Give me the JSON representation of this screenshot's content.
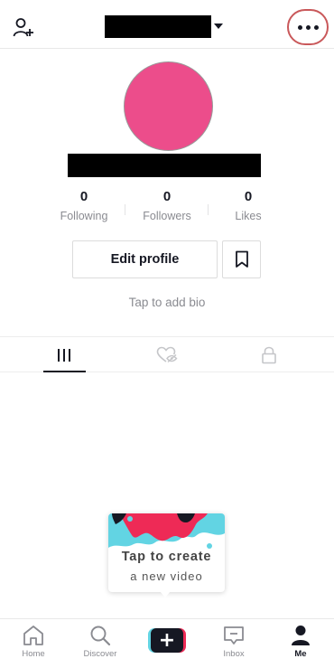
{
  "header": {
    "username_redacted": true,
    "more_menu_highlighted": true
  },
  "profile": {
    "avatar_color": "#ec4d8b",
    "stats": [
      {
        "value": "0",
        "label": "Following"
      },
      {
        "value": "0",
        "label": "Followers"
      },
      {
        "value": "0",
        "label": "Likes"
      }
    ],
    "edit_profile_label": "Edit profile",
    "bio_prompt": "Tap to add bio"
  },
  "tabs": {
    "active": "videos",
    "items": [
      "videos-grid",
      "liked-hidden",
      "private-lock"
    ]
  },
  "create_prompt": {
    "title": "Tap to create",
    "subtitle": "a new video"
  },
  "bottom_nav": {
    "active": "Me",
    "items": [
      {
        "label": "Home",
        "icon": "home-icon"
      },
      {
        "label": "Discover",
        "icon": "search-icon"
      },
      {
        "label": "",
        "icon": "plus-icon"
      },
      {
        "label": "Inbox",
        "icon": "inbox-icon"
      },
      {
        "label": "Me",
        "icon": "person-icon"
      }
    ]
  },
  "colors": {
    "highlight_ring": "#c9585a",
    "brand_cyan": "#62d4e3",
    "brand_pink": "#ee2a56",
    "text_dark": "#161823",
    "text_muted": "#8a8b91"
  }
}
